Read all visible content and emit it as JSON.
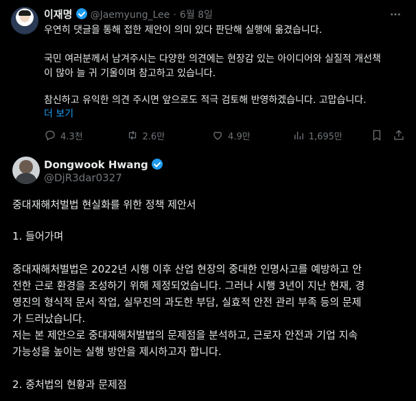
{
  "tweet1": {
    "name": "이재명",
    "handle": "@Jaemyung_Lee",
    "separator": "·",
    "date": "6월 8일",
    "lines": [
      "우연히 댓글을 통해 접한 제안이 의미 있다 판단해 실행에 옮겼습니다.",
      "국민 여러분께서 남겨주시는 다양한 의견에는 현장감 있는 아이디어와 실질적 개선책",
      "이 많아 늘 귀 기울이며 참고하고 있습니다.",
      "참신하고 유익한 의견 주시면 앞으로도 적극 검토해 반영하겠습니다. 고맙습니다."
    ],
    "more": "더 보기",
    "stats": {
      "replies": "4.3천",
      "retweets": "2.6만",
      "likes": "4.9만",
      "views": "1,695만"
    }
  },
  "tweet2": {
    "name": "Dongwook Hwang",
    "handle": "@DjR3dar0327",
    "lines": [
      "중대재해처벌법 현실화를 위한 정책 제안서",
      "1. 들어가며",
      "중대재해처벌법은 2022년 시행 이후 산업 현장의 중대한 인명사고를 예방하고 안",
      "전한 근로 환경을 조성하기 위해 제정되었습니다. 그러나 시행 3년이 지난 현재, 경",
      "영진의 형식적 문서 작업, 실무진의 과도한 부담, 실효적 안전 관리 부족 등의 문제",
      "가 드러났습니다.",
      "저는 본 제안으로 중대재해처벌법의 문제점을 분석하고, 근로자 안전과 기업 지속",
      "가능성을 높이는 실행 방안을 제시하고자 합니다.",
      "2. 중처법의 현황과 문제점"
    ]
  },
  "colors": {
    "background": "#000000",
    "text": "#e7e9ea",
    "muted": "#71767b",
    "accent": "#1d9bf0"
  }
}
